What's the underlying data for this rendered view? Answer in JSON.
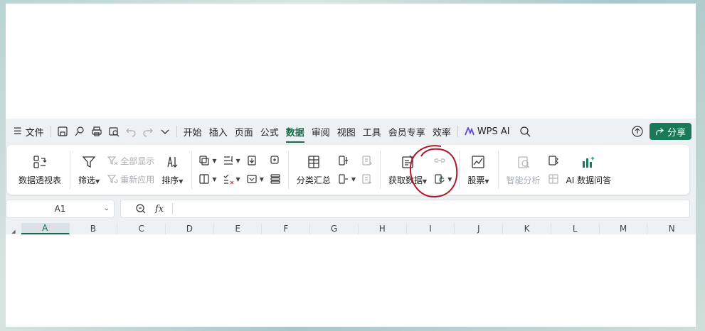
{
  "menu": {
    "file": "文件",
    "tabs": [
      "开始",
      "插入",
      "页面",
      "公式",
      "数据",
      "审阅",
      "视图",
      "工具",
      "会员专享",
      "效率"
    ],
    "active_tab": "数据",
    "wps_ai": "WPS AI",
    "share": "分享"
  },
  "ribbon": {
    "pivot": "数据透视表",
    "filter": "筛选",
    "show_all": "全部显示",
    "reapply": "重新应用",
    "sort": "排序",
    "subtotal": "分类汇总",
    "get_data": "获取数据",
    "stocks": "股票",
    "smart_analysis": "智能分析",
    "ai_qa": "AI 数据问答"
  },
  "formula_bar": {
    "cell_ref": "A1",
    "fx": "fx",
    "value": ""
  },
  "columns": [
    "A",
    "B",
    "C",
    "D",
    "E",
    "F",
    "G",
    "H",
    "I",
    "J",
    "K",
    "L",
    "M",
    "N"
  ],
  "selected_column": "A",
  "colors": {
    "accent": "#1a6b4b",
    "share_bg": "#1a7a58",
    "annotation": "#b0182a"
  }
}
